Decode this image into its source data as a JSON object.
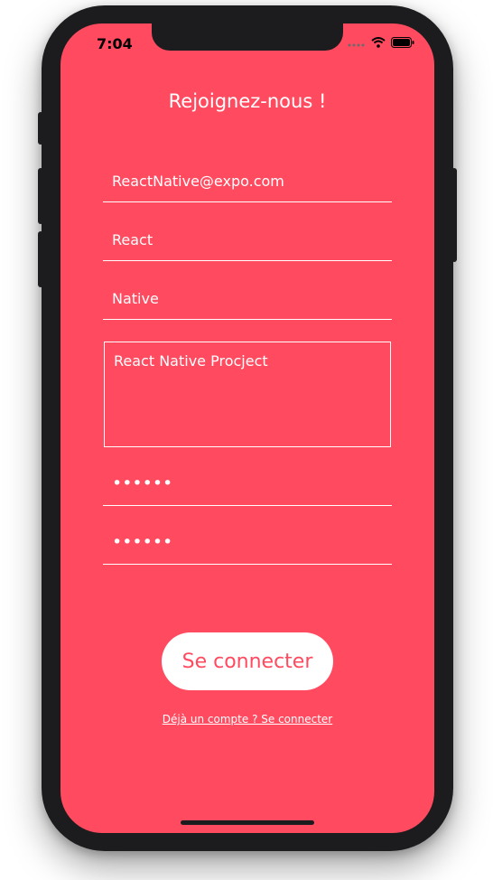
{
  "status_bar": {
    "time": "7:04",
    "icons": [
      "signal-icon",
      "wifi-icon",
      "battery-icon"
    ]
  },
  "screen": {
    "background_color": "#ff4a5f",
    "title": "Rejoignez-nous !"
  },
  "form": {
    "email_value": "ReactNative@expo.com",
    "first_name_value": "React",
    "last_name_value": "Native",
    "description_value": "React Native Procject",
    "password_value": "••••••",
    "confirm_password_value": "••••••"
  },
  "actions": {
    "connect_label": "Se connecter",
    "login_link_label": "Déjà un compte ? Se connecter"
  }
}
